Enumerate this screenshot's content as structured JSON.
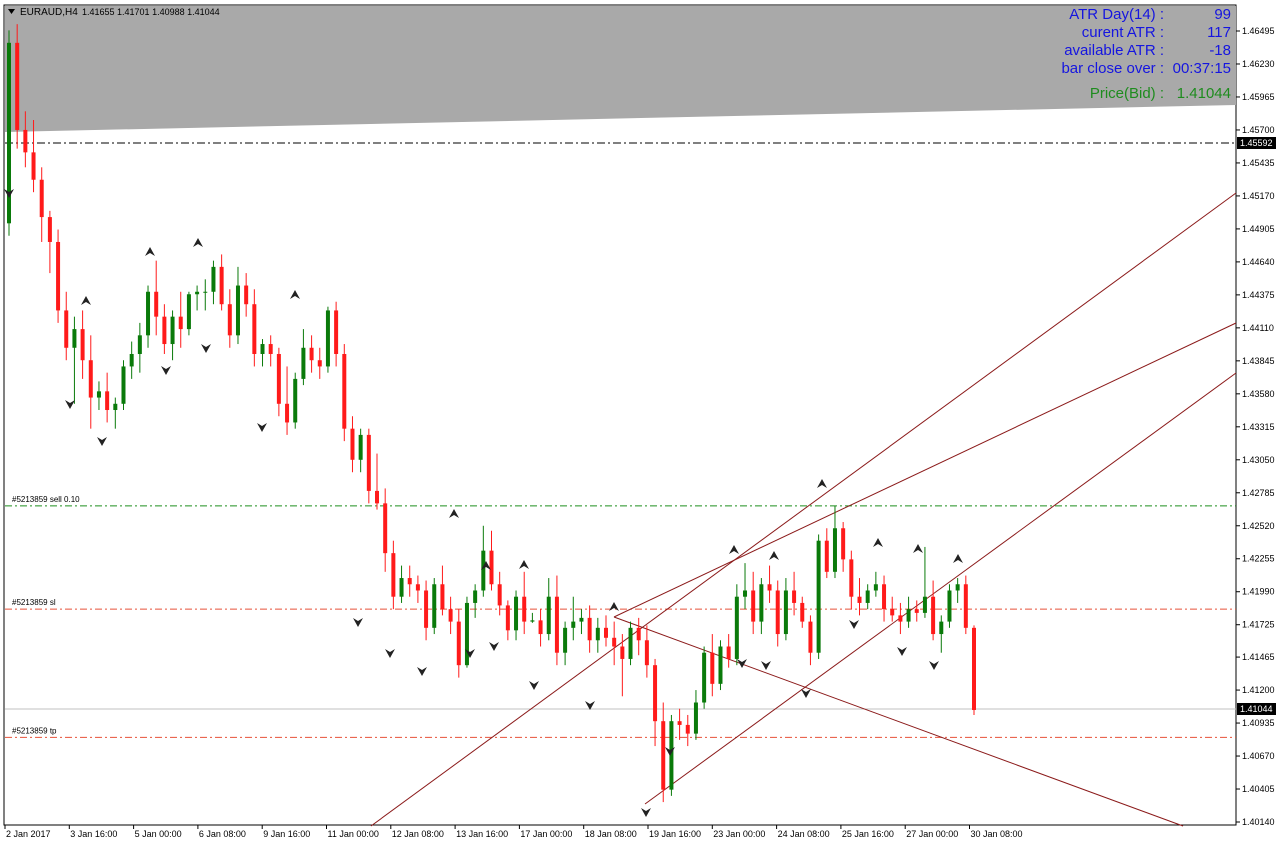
{
  "window": {
    "symbol_label": "EURAUD,H4",
    "ohlc_label": "1.41655 1.41701 1.40988 1.41044",
    "menu_icon": "triangle-down-icon"
  },
  "info_panel": {
    "rows": [
      {
        "label": "ATR Day(14) :",
        "value": "99"
      },
      {
        "label": "curent ATR :",
        "value": "117"
      },
      {
        "label": "available ATR :",
        "value": "-18"
      },
      {
        "label": "bar close over :",
        "value": "00:37:15"
      }
    ],
    "price_label": "Price(Bid) :",
    "price_value": "1.41044"
  },
  "order_lines": [
    {
      "label": "#5213859 sell 0.10",
      "price": 1.4268,
      "kind": "entry"
    },
    {
      "label": "#5213859 sl",
      "price": 1.4185,
      "kind": "sl"
    },
    {
      "label": "#5213859 tp",
      "price": 1.4082,
      "kind": "tp"
    }
  ],
  "colors": {
    "bull": "#0a7a0a",
    "bear": "#ff1a1a",
    "entry_line": "#1f8f1f",
    "sl_line": "#e8523a",
    "tp_line": "#e8523a",
    "trend_line": "#8b1a1a",
    "info_text": "#1515e0",
    "price_text": "#1e8c1e",
    "shade": "#a9a9a9"
  },
  "chart_data": {
    "type": "candlestick",
    "symbol": "EURAUD",
    "timeframe": "H4",
    "price_axis_ticks": [
      "1.46495",
      "1.46230",
      "1.45965",
      "1.45700",
      "1.45435",
      "1.45170",
      "1.44905",
      "1.44640",
      "1.44375",
      "1.44110",
      "1.43845",
      "1.43580",
      "1.43315",
      "1.43050",
      "1.42785",
      "1.42520",
      "1.42255",
      "1.41990",
      "1.41725",
      "1.41465",
      "1.41200",
      "1.40935",
      "1.40670",
      "1.40405",
      "1.40140"
    ],
    "time_axis_ticks": [
      "2 Jan 2017",
      "3 Jan 16:00",
      "5 Jan 00:00",
      "6 Jan 08:00",
      "9 Jan 16:00",
      "11 Jan 00:00",
      "12 Jan 08:00",
      "13 Jan 16:00",
      "17 Jan 00:00",
      "18 Jan 08:00",
      "19 Jan 16:00",
      "23 Jan 00:00",
      "24 Jan 08:00",
      "25 Jan 16:00",
      "27 Jan 00:00",
      "30 Jan 08:00"
    ],
    "y_range": [
      1.4008,
      1.4672
    ],
    "horizontal_line_price": "1.45592",
    "current_bid": "1.41044",
    "candles": [
      [
        1.4495,
        1.465,
        1.4485,
        1.464
      ],
      [
        1.464,
        1.4655,
        1.4555,
        1.457
      ],
      [
        1.457,
        1.4585,
        1.454,
        1.4552
      ],
      [
        1.4552,
        1.4578,
        1.452,
        1.453
      ],
      [
        1.453,
        1.454,
        1.448,
        1.45
      ],
      [
        1.45,
        1.4505,
        1.4455,
        1.448
      ],
      [
        1.448,
        1.449,
        1.4415,
        1.4425
      ],
      [
        1.4425,
        1.444,
        1.4385,
        1.4395
      ],
      [
        1.4395,
        1.442,
        1.435,
        1.441
      ],
      [
        1.441,
        1.4425,
        1.437,
        1.4385
      ],
      [
        1.4385,
        1.4405,
        1.433,
        1.4355
      ],
      [
        1.4355,
        1.4368,
        1.4345,
        1.436
      ],
      [
        1.436,
        1.4375,
        1.4335,
        1.4345
      ],
      [
        1.4345,
        1.4355,
        1.433,
        1.435
      ],
      [
        1.435,
        1.4385,
        1.4345,
        1.438
      ],
      [
        1.438,
        1.44,
        1.437,
        1.439
      ],
      [
        1.439,
        1.4415,
        1.4375,
        1.4405
      ],
      [
        1.4405,
        1.4445,
        1.4395,
        1.444
      ],
      [
        1.444,
        1.4465,
        1.4405,
        1.442
      ],
      [
        1.442,
        1.443,
        1.439,
        1.4398
      ],
      [
        1.4398,
        1.4425,
        1.4385,
        1.442
      ],
      [
        1.442,
        1.444,
        1.4395,
        1.441
      ],
      [
        1.441,
        1.444,
        1.4405,
        1.4438
      ],
      [
        1.4438,
        1.4445,
        1.4425,
        1.444
      ],
      [
        1.444,
        1.445,
        1.4425,
        1.444
      ],
      [
        1.444,
        1.4465,
        1.443,
        1.446
      ],
      [
        1.446,
        1.447,
        1.4425,
        1.443
      ],
      [
        1.443,
        1.4442,
        1.4395,
        1.4405
      ],
      [
        1.4405,
        1.446,
        1.4398,
        1.4445
      ],
      [
        1.4445,
        1.4455,
        1.442,
        1.443
      ],
      [
        1.443,
        1.4442,
        1.438,
        1.439
      ],
      [
        1.439,
        1.4402,
        1.438,
        1.4398
      ],
      [
        1.4398,
        1.4405,
        1.438,
        1.439
      ],
      [
        1.439,
        1.4395,
        1.434,
        1.435
      ],
      [
        1.435,
        1.438,
        1.4325,
        1.4335
      ],
      [
        1.4335,
        1.4375,
        1.433,
        1.437
      ],
      [
        1.437,
        1.441,
        1.4365,
        1.4395
      ],
      [
        1.4395,
        1.4405,
        1.4375,
        1.4385
      ],
      [
        1.4385,
        1.4395,
        1.437,
        1.438
      ],
      [
        1.438,
        1.4428,
        1.4375,
        1.4425
      ],
      [
        1.4425,
        1.4432,
        1.438,
        1.439
      ],
      [
        1.439,
        1.4398,
        1.432,
        1.433
      ],
      [
        1.433,
        1.434,
        1.4295,
        1.4305
      ],
      [
        1.4305,
        1.433,
        1.4295,
        1.4325
      ],
      [
        1.4325,
        1.433,
        1.427,
        1.428
      ],
      [
        1.428,
        1.431,
        1.4265,
        1.427
      ],
      [
        1.427,
        1.4282,
        1.4215,
        1.423
      ],
      [
        1.423,
        1.424,
        1.4185,
        1.4195
      ],
      [
        1.4195,
        1.422,
        1.419,
        1.421
      ],
      [
        1.421,
        1.422,
        1.4195,
        1.4205
      ],
      [
        1.4205,
        1.4212,
        1.419,
        1.42
      ],
      [
        1.42,
        1.4208,
        1.416,
        1.417
      ],
      [
        1.417,
        1.421,
        1.4165,
        1.4205
      ],
      [
        1.4205,
        1.422,
        1.418,
        1.4185
      ],
      [
        1.4185,
        1.4195,
        1.4165,
        1.4175
      ],
      [
        1.4175,
        1.4185,
        1.413,
        1.414
      ],
      [
        1.414,
        1.4195,
        1.4138,
        1.419
      ],
      [
        1.419,
        1.4205,
        1.4178,
        1.42
      ],
      [
        1.42,
        1.4252,
        1.4195,
        1.4232
      ],
      [
        1.4232,
        1.4248,
        1.42,
        1.4205
      ],
      [
        1.4205,
        1.4215,
        1.418,
        1.4188
      ],
      [
        1.4188,
        1.4192,
        1.416,
        1.4168
      ],
      [
        1.4168,
        1.42,
        1.416,
        1.4195
      ],
      [
        1.4195,
        1.4215,
        1.4165,
        1.4175
      ],
      [
        1.4175,
        1.4182,
        1.4174,
        1.4176
      ],
      [
        1.4176,
        1.4185,
        1.4155,
        1.4165
      ],
      [
        1.4165,
        1.421,
        1.416,
        1.4195
      ],
      [
        1.4195,
        1.4212,
        1.414,
        1.415
      ],
      [
        1.415,
        1.4175,
        1.414,
        1.417
      ],
      [
        1.417,
        1.4195,
        1.416,
        1.4175
      ],
      [
        1.4175,
        1.4185,
        1.4165,
        1.4178
      ],
      [
        1.4178,
        1.4188,
        1.415,
        1.416
      ],
      [
        1.416,
        1.4178,
        1.415,
        1.417
      ],
      [
        1.417,
        1.418,
        1.4155,
        1.4162
      ],
      [
        1.4162,
        1.4175,
        1.414,
        1.4155
      ],
      [
        1.4155,
        1.4165,
        1.4115,
        1.4145
      ],
      [
        1.4145,
        1.4175,
        1.414,
        1.417
      ],
      [
        1.417,
        1.4178,
        1.4148,
        1.416
      ],
      [
        1.416,
        1.4172,
        1.413,
        1.414
      ],
      [
        1.414,
        1.4145,
        1.4075,
        1.4095
      ],
      [
        1.4095,
        1.411,
        1.403,
        1.404
      ],
      [
        1.404,
        1.41,
        1.4035,
        1.4095
      ],
      [
        1.4095,
        1.4105,
        1.408,
        1.4092
      ],
      [
        1.4092,
        1.41,
        1.4075,
        1.4085
      ],
      [
        1.4085,
        1.412,
        1.408,
        1.411
      ],
      [
        1.411,
        1.4155,
        1.4105,
        1.415
      ],
      [
        1.415,
        1.4165,
        1.4115,
        1.4125
      ],
      [
        1.4125,
        1.416,
        1.412,
        1.4155
      ],
      [
        1.4155,
        1.4165,
        1.4138,
        1.4145
      ],
      [
        1.4145,
        1.4205,
        1.414,
        1.4195
      ],
      [
        1.4195,
        1.4222,
        1.4185,
        1.42
      ],
      [
        1.42,
        1.4215,
        1.4165,
        1.4175
      ],
      [
        1.4175,
        1.421,
        1.4165,
        1.4205
      ],
      [
        1.4205,
        1.422,
        1.419,
        1.42
      ],
      [
        1.42,
        1.4208,
        1.4155,
        1.4165
      ],
      [
        1.4165,
        1.421,
        1.416,
        1.42
      ],
      [
        1.42,
        1.4215,
        1.418,
        1.419
      ],
      [
        1.419,
        1.4195,
        1.417,
        1.4175
      ],
      [
        1.4175,
        1.418,
        1.414,
        1.415
      ],
      [
        1.415,
        1.4245,
        1.4145,
        1.424
      ],
      [
        1.424,
        1.425,
        1.421,
        1.4215
      ],
      [
        1.4215,
        1.4268,
        1.421,
        1.425
      ],
      [
        1.425,
        1.4255,
        1.4215,
        1.4225
      ],
      [
        1.4225,
        1.4232,
        1.4185,
        1.4195
      ],
      [
        1.4195,
        1.421,
        1.418,
        1.419
      ],
      [
        1.419,
        1.4205,
        1.4185,
        1.42
      ],
      [
        1.42,
        1.4215,
        1.4195,
        1.4205
      ],
      [
        1.4205,
        1.4212,
        1.4175,
        1.4185
      ],
      [
        1.4185,
        1.4195,
        1.4175,
        1.418
      ],
      [
        1.418,
        1.419,
        1.4165,
        1.4175
      ],
      [
        1.4175,
        1.4195,
        1.417,
        1.4185
      ],
      [
        1.4185,
        1.4192,
        1.4175,
        1.4182
      ],
      [
        1.4182,
        1.4235,
        1.4178,
        1.4195
      ],
      [
        1.4195,
        1.4208,
        1.416,
        1.4165
      ],
      [
        1.4165,
        1.418,
        1.415,
        1.4175
      ],
      [
        1.4175,
        1.4205,
        1.417,
        1.42
      ],
      [
        1.42,
        1.421,
        1.419,
        1.4205
      ],
      [
        1.4205,
        1.4212,
        1.4165,
        1.417
      ],
      [
        1.417,
        1.4172,
        1.41,
        1.4104
      ]
    ]
  }
}
